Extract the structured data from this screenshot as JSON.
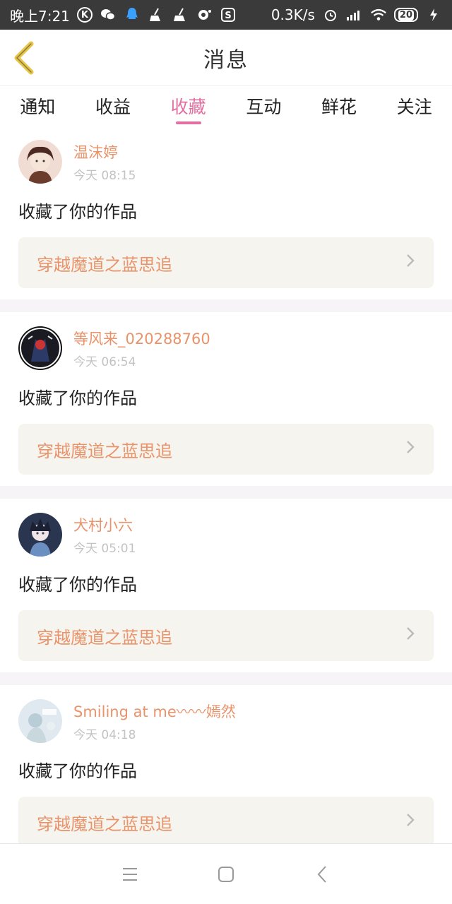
{
  "status_bar": {
    "time": "晚上7:21",
    "network_speed": "0.3K/s",
    "battery": "20",
    "icons": [
      "k-icon",
      "wechat-icon",
      "qq-icon",
      "broom-icon",
      "broom-icon-2",
      "camera-dot-icon",
      "s-icon",
      "alarm-icon",
      "signal-icon",
      "wifi-icon",
      "battery-icon",
      "charging-icon"
    ]
  },
  "header": {
    "title": "消息"
  },
  "tabs": [
    {
      "label": "通知"
    },
    {
      "label": "收益"
    },
    {
      "label": "收藏"
    },
    {
      "label": "互动"
    },
    {
      "label": "鲜花"
    },
    {
      "label": "关注"
    }
  ],
  "active_tab_index": 2,
  "feed": [
    {
      "username": "温沫婷",
      "time": "今天 08:15",
      "action": "收藏了你的作品",
      "work_title": "穿越魔道之蓝思追",
      "avatar": "avatar-1"
    },
    {
      "username": "等风来_020288760",
      "time": "今天 06:54",
      "action": "收藏了你的作品",
      "work_title": "穿越魔道之蓝思追",
      "avatar": "avatar-2"
    },
    {
      "username": "犬村小六",
      "time": "今天 05:01",
      "action": "收藏了你的作品",
      "work_title": "穿越魔道之蓝思追",
      "avatar": "avatar-3"
    },
    {
      "username": "Smiling at me〰〰嫣然",
      "time": "今天 04:18",
      "action": "收藏了你的作品",
      "work_title": "穿越魔道之蓝思追",
      "avatar": "avatar-4"
    }
  ],
  "colors": {
    "accent": "#e36fa0",
    "name": "#e9936b",
    "card_bg": "#f6f4ee",
    "back": "#e8c44a"
  }
}
